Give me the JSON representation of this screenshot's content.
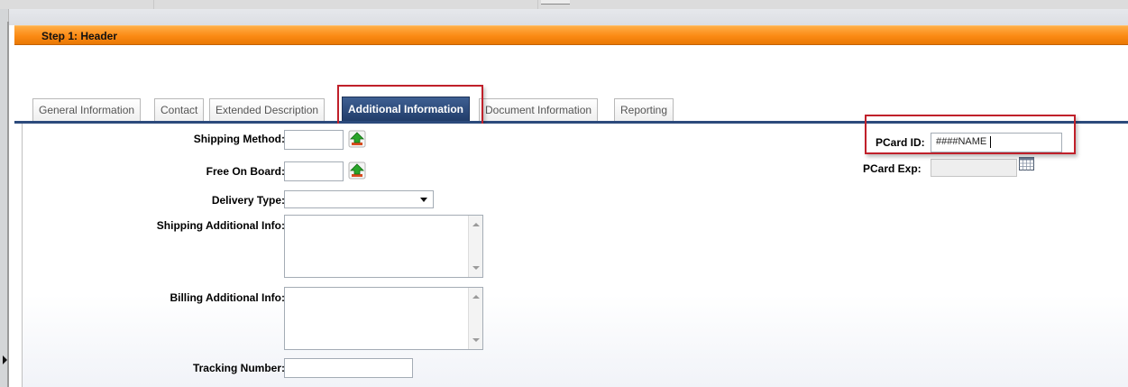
{
  "header": {
    "step_title": "Step 1: Header"
  },
  "tabs": [
    {
      "label": "General Information",
      "active": false
    },
    {
      "label": "Contact",
      "active": false
    },
    {
      "label": "Extended Description",
      "active": false
    },
    {
      "label": "Additional Information",
      "active": true
    },
    {
      "label": "Document Information",
      "active": false
    },
    {
      "label": "Reporting",
      "active": false
    }
  ],
  "form": {
    "shipping_method": {
      "label": "Shipping Method:",
      "value": ""
    },
    "free_on_board": {
      "label": "Free On Board:",
      "value": ""
    },
    "delivery_type": {
      "label": "Delivery Type:",
      "value": ""
    },
    "shipping_additional_info": {
      "label": "Shipping Additional Info:",
      "value": ""
    },
    "billing_additional_info": {
      "label": "Billing Additional Info:",
      "value": ""
    },
    "tracking_number": {
      "label": "Tracking Number:",
      "value": ""
    },
    "pcard_id": {
      "label": "PCard ID:",
      "value": "####NAME"
    },
    "pcard_exp": {
      "label": "PCard Exp:",
      "value": ""
    }
  },
  "icons": {
    "lookup": "lookup-arrow-icon",
    "calendar": "calendar-icon",
    "dropdown": "chevron-down-icon"
  },
  "colors": {
    "header_orange": "#fb8a14",
    "active_tab": "#2c4a7c",
    "highlight_red": "#c0202a"
  }
}
